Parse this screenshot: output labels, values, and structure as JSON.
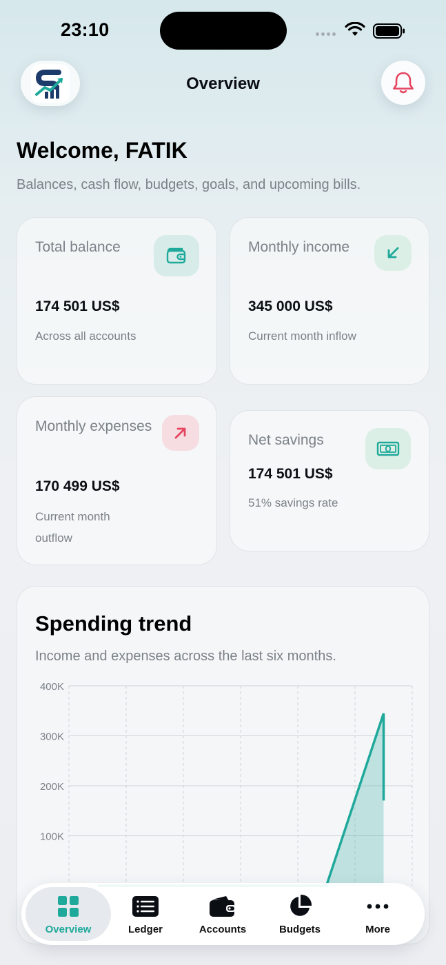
{
  "status_bar": {
    "time": "23:10"
  },
  "header": {
    "title": "Overview"
  },
  "welcome": {
    "title": "Welcome, FATIK",
    "subtitle": "Balances, cash flow, budgets, goals, and upcoming bills."
  },
  "cards": {
    "total_balance": {
      "label": "Total balance",
      "value": "174 501 US$",
      "note": "Across all accounts",
      "icon": "wallet-icon"
    },
    "monthly_income": {
      "label": "Monthly income",
      "value": "345 000 US$",
      "note": "Current month inflow",
      "icon": "arrow-down-left-icon"
    },
    "monthly_expenses": {
      "label": "Monthly expenses",
      "value": "170 499 US$",
      "note": "Current month outflow",
      "icon": "arrow-up-right-icon"
    },
    "net_savings": {
      "label": "Net savings",
      "value": "174 501 US$",
      "note": "51% savings rate",
      "icon": "banknote-icon"
    }
  },
  "colors": {
    "accent": "#1fa99a",
    "income_chip": "#dcefe6",
    "expense_chip": "#f6dde1",
    "balance_chip": "#d7ece9",
    "expense_red": "#e64560"
  },
  "trend": {
    "title": "Spending trend",
    "subtitle": "Income and expenses across the last six months."
  },
  "chart_data": {
    "type": "area",
    "yticks": [
      "400K",
      "300K",
      "200K",
      "100K"
    ],
    "ylim": [
      0,
      400000
    ],
    "x_count": 6,
    "series": [
      {
        "values": [
          0,
          0,
          0,
          0,
          0,
          345000
        ]
      },
      {
        "values": [
          0,
          0,
          0,
          0,
          0,
          170499
        ]
      }
    ],
    "grid": true
  },
  "tabbar": {
    "items": [
      {
        "label": "Overview",
        "icon": "grid-icon",
        "active": true
      },
      {
        "label": "Ledger",
        "icon": "list-icon",
        "active": false
      },
      {
        "label": "Accounts",
        "icon": "wallet-icon",
        "active": false
      },
      {
        "label": "Budgets",
        "icon": "pie-chart-icon",
        "active": false
      },
      {
        "label": "More",
        "icon": "ellipsis-icon",
        "active": false
      }
    ]
  }
}
